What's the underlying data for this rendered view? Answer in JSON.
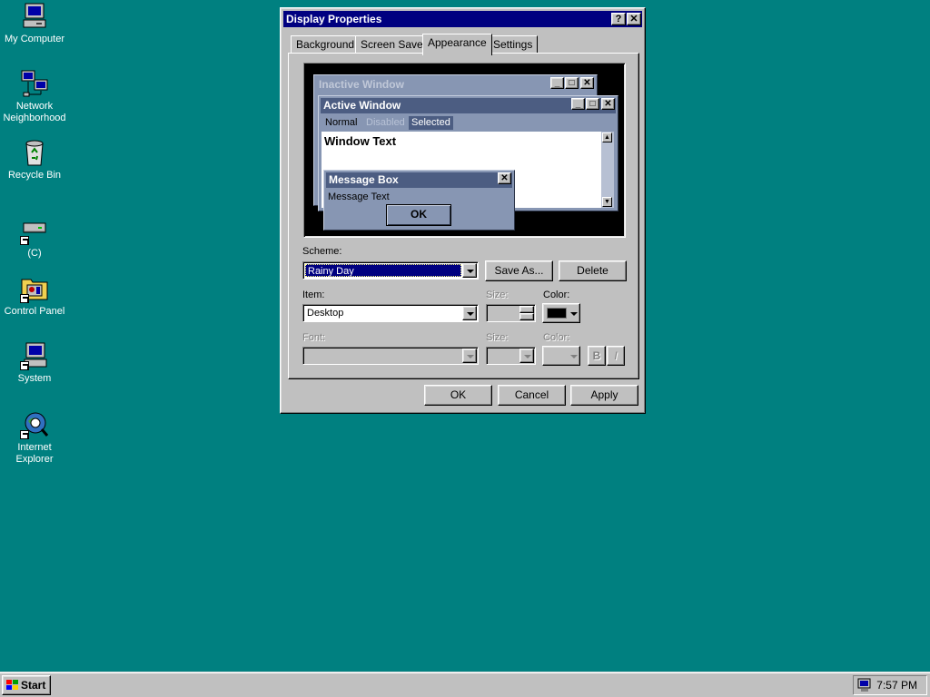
{
  "desktop": {
    "icons": [
      {
        "label": "My Computer",
        "icon": "computer-icon"
      },
      {
        "label": "Network Neighborhood",
        "icon": "network-icon"
      },
      {
        "label": "Recycle Bin",
        "icon": "recycle-bin-icon"
      },
      {
        "label": "(C)",
        "icon": "drive-shortcut-icon"
      },
      {
        "label": "Control Panel",
        "icon": "control-panel-icon"
      },
      {
        "label": "System",
        "icon": "system-shortcut-icon"
      },
      {
        "label": "Internet Explorer",
        "icon": "internet-explorer-icon"
      }
    ],
    "background": "#008080"
  },
  "dialog": {
    "title": "Display Properties",
    "title_buttons": {
      "help": "?",
      "close": "✕"
    },
    "tabs": [
      {
        "label": "Background",
        "active": false
      },
      {
        "label": "Screen Saver",
        "active": false
      },
      {
        "label": "Appearance",
        "active": true
      },
      {
        "label": "Settings",
        "active": false
      }
    ],
    "preview": {
      "inactive_title": "Inactive Window",
      "active_title": "Active Window",
      "menu_items": [
        "Normal",
        "Disabled",
        "Selected"
      ],
      "window_text": "Window Text",
      "message_box_title": "Message Box",
      "message_text": "Message Text",
      "ok_label": "OK",
      "colors": {
        "window_face": "#8796b3",
        "active_caption": "#4c5d82",
        "inactive_caption": "#8796b3",
        "selected": "#4c5d82"
      }
    },
    "scheme": {
      "label": "Scheme:",
      "value": "Rainy Day",
      "save_as": "Save As...",
      "delete": "Delete"
    },
    "item": {
      "label": "Item:",
      "value": "Desktop",
      "size_label": "Size:",
      "color_label": "Color:",
      "color_value": "#000000"
    },
    "font": {
      "label": "Font:",
      "size_label": "Size:",
      "color_label": "Color:",
      "bold": "B",
      "italic": "I"
    },
    "buttons": {
      "ok": "OK",
      "cancel": "Cancel",
      "apply": "Apply"
    }
  },
  "taskbar": {
    "start_label": "Start",
    "clock": "7:57 PM"
  }
}
